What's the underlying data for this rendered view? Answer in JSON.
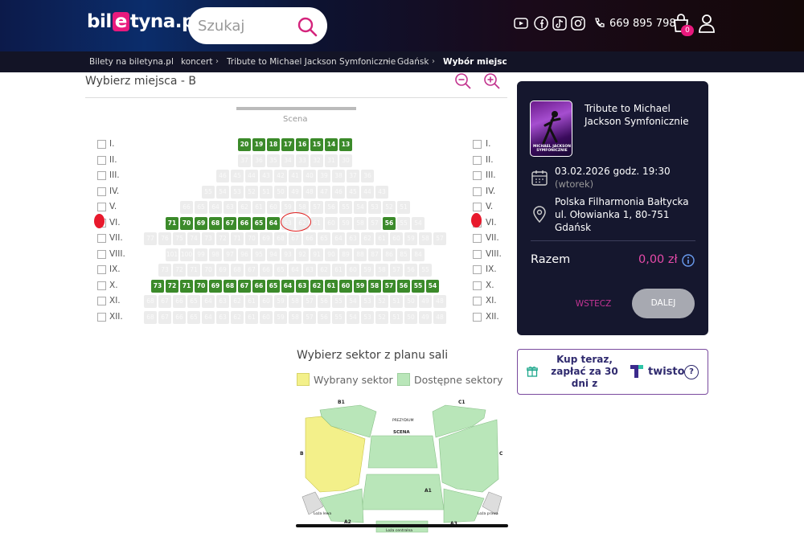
{
  "header": {
    "logo_prefix": "bil",
    "logo_e": "e",
    "logo_suffix": "tyna.pl",
    "search_placeholder": "Szukaj",
    "phone": "669 895 798",
    "cart_count": "0",
    "social_icons": [
      "youtube-icon",
      "facebook-icon",
      "tiktok-icon",
      "instagram-icon"
    ]
  },
  "breadcrumb": [
    "Bilety na biletyna.pl",
    "koncert",
    "Tribute to Michael Jackson Symfonicznie",
    "Gdańsk",
    "Wybór miejsc"
  ],
  "seat_map": {
    "title": "Wybierz miejsca - B",
    "stage_label": "Scena",
    "rows": [
      {
        "label": "I.",
        "seats": [
          {
            "n": "20",
            "a": 1
          },
          {
            "n": "19",
            "a": 1
          },
          {
            "n": "18",
            "a": 1
          },
          {
            "n": "17",
            "a": 1
          },
          {
            "n": "16",
            "a": 1
          },
          {
            "n": "15",
            "a": 1
          },
          {
            "n": "14",
            "a": 1
          },
          {
            "n": "13",
            "a": 1
          }
        ]
      },
      {
        "label": "II.",
        "seats": [
          {
            "n": "37",
            "a": 0
          },
          {
            "n": "36",
            "a": 0
          },
          {
            "n": "35",
            "a": 0
          },
          {
            "n": "34",
            "a": 0
          },
          {
            "n": "33",
            "a": 0
          },
          {
            "n": "32",
            "a": 0
          },
          {
            "n": "31",
            "a": 0
          },
          {
            "n": "30",
            "a": 0
          }
        ]
      },
      {
        "label": "III.",
        "seats": [
          {
            "n": "46",
            "a": 0
          },
          {
            "n": "45",
            "a": 0
          },
          {
            "n": "44",
            "a": 0
          },
          {
            "n": "43",
            "a": 0
          },
          {
            "n": "42",
            "a": 0
          },
          {
            "n": "41",
            "a": 0
          },
          {
            "n": "40",
            "a": 0
          },
          {
            "n": "39",
            "a": 0
          },
          {
            "n": "38",
            "a": 0
          },
          {
            "n": "37",
            "a": 0
          },
          {
            "n": "36",
            "a": 0
          }
        ]
      },
      {
        "label": "IV.",
        "seats": [
          {
            "n": "55",
            "a": 0
          },
          {
            "n": "54",
            "a": 0
          },
          {
            "n": "53",
            "a": 0
          },
          {
            "n": "52",
            "a": 0
          },
          {
            "n": "51",
            "a": 0
          },
          {
            "n": "50",
            "a": 0
          },
          {
            "n": "49",
            "a": 0
          },
          {
            "n": "48",
            "a": 0
          },
          {
            "n": "47",
            "a": 0
          },
          {
            "n": "46",
            "a": 0
          },
          {
            "n": "45",
            "a": 0
          },
          {
            "n": "44",
            "a": 0
          },
          {
            "n": "43",
            "a": 0
          }
        ]
      },
      {
        "label": "V.",
        "seats": [
          {
            "n": "66",
            "a": 0
          },
          {
            "n": "65",
            "a": 0
          },
          {
            "n": "64",
            "a": 0
          },
          {
            "n": "63",
            "a": 0
          },
          {
            "n": "62",
            "a": 0
          },
          {
            "n": "61",
            "a": 0
          },
          {
            "n": "60",
            "a": 0
          },
          {
            "n": "59",
            "a": 0
          },
          {
            "n": "58",
            "a": 0
          },
          {
            "n": "57",
            "a": 0
          },
          {
            "n": "56",
            "a": 0
          },
          {
            "n": "55",
            "a": 0
          },
          {
            "n": "54",
            "a": 0
          },
          {
            "n": "53",
            "a": 0
          },
          {
            "n": "52",
            "a": 0
          },
          {
            "n": "51",
            "a": 0
          }
        ]
      },
      {
        "label": "VI.",
        "seats": [
          {
            "n": "71",
            "a": 1
          },
          {
            "n": "70",
            "a": 1
          },
          {
            "n": "69",
            "a": 1
          },
          {
            "n": "68",
            "a": 1
          },
          {
            "n": "67",
            "a": 1
          },
          {
            "n": "66",
            "a": 1
          },
          {
            "n": "65",
            "a": 1
          },
          {
            "n": "64",
            "a": 1
          },
          {
            "n": "63",
            "a": 0
          },
          {
            "n": "62",
            "a": 0
          },
          {
            "n": "61",
            "a": 0
          },
          {
            "n": "60",
            "a": 0
          },
          {
            "n": "59",
            "a": 0
          },
          {
            "n": "58",
            "a": 0
          },
          {
            "n": "57",
            "a": 0
          },
          {
            "n": "56",
            "a": 1
          },
          {
            "n": "55",
            "a": 0
          },
          {
            "n": "54",
            "a": 0
          }
        ]
      },
      {
        "label": "VII.",
        "seats": [
          {
            "n": "77",
            "a": 0
          },
          {
            "n": "76",
            "a": 0
          },
          {
            "n": "75",
            "a": 0
          },
          {
            "n": "74",
            "a": 0
          },
          {
            "n": "73",
            "a": 0
          },
          {
            "n": "72",
            "a": 0
          },
          {
            "n": "71",
            "a": 0
          },
          {
            "n": "70",
            "a": 0
          },
          {
            "n": "69",
            "a": 0
          },
          {
            "n": "68",
            "a": 0
          },
          {
            "n": "67",
            "a": 0
          },
          {
            "n": "66",
            "a": 0
          },
          {
            "n": "65",
            "a": 0
          },
          {
            "n": "64",
            "a": 0
          },
          {
            "n": "63",
            "a": 0
          },
          {
            "n": "62",
            "a": 0
          },
          {
            "n": "61",
            "a": 0
          },
          {
            "n": "60",
            "a": 0
          },
          {
            "n": "59",
            "a": 0
          },
          {
            "n": "58",
            "a": 0
          },
          {
            "n": "57",
            "a": 0
          }
        ]
      },
      {
        "label": "VIII.",
        "seats": [
          {
            "n": "101",
            "a": 0
          },
          {
            "n": "100",
            "a": 0
          },
          {
            "n": "99",
            "a": 0
          },
          {
            "n": "98",
            "a": 0
          },
          {
            "n": "97",
            "a": 0
          },
          {
            "n": "96",
            "a": 0
          },
          {
            "n": "95",
            "a": 0
          },
          {
            "n": "94",
            "a": 0
          },
          {
            "n": "93",
            "a": 0
          },
          {
            "n": "92",
            "a": 0
          },
          {
            "n": "91",
            "a": 0
          },
          {
            "n": "90",
            "a": 0
          },
          {
            "n": "89",
            "a": 0
          },
          {
            "n": "88",
            "a": 0
          },
          {
            "n": "87",
            "a": 0
          },
          {
            "n": "86",
            "a": 0
          },
          {
            "n": "85",
            "a": 0
          },
          {
            "n": "84",
            "a": 0
          }
        ]
      },
      {
        "label": "IX.",
        "seats": [
          {
            "n": "73",
            "a": 0
          },
          {
            "n": "72",
            "a": 0
          },
          {
            "n": "71",
            "a": 0
          },
          {
            "n": "70",
            "a": 0
          },
          {
            "n": "69",
            "a": 0
          },
          {
            "n": "68",
            "a": 0
          },
          {
            "n": "67",
            "a": 0
          },
          {
            "n": "66",
            "a": 0
          },
          {
            "n": "65",
            "a": 0
          },
          {
            "n": "64",
            "a": 0
          },
          {
            "n": "63",
            "a": 0
          },
          {
            "n": "62",
            "a": 0
          },
          {
            "n": "61",
            "a": 0
          },
          {
            "n": "60",
            "a": 0
          },
          {
            "n": "59",
            "a": 0
          },
          {
            "n": "58",
            "a": 0
          },
          {
            "n": "57",
            "a": 0
          },
          {
            "n": "56",
            "a": 0
          },
          {
            "n": "55",
            "a": 0
          }
        ]
      },
      {
        "label": "X.",
        "seats": [
          {
            "n": "73",
            "a": 1
          },
          {
            "n": "72",
            "a": 1
          },
          {
            "n": "71",
            "a": 1
          },
          {
            "n": "70",
            "a": 1
          },
          {
            "n": "69",
            "a": 1
          },
          {
            "n": "68",
            "a": 1
          },
          {
            "n": "67",
            "a": 1
          },
          {
            "n": "66",
            "a": 1
          },
          {
            "n": "65",
            "a": 1
          },
          {
            "n": "64",
            "a": 1
          },
          {
            "n": "63",
            "a": 1
          },
          {
            "n": "62",
            "a": 1
          },
          {
            "n": "61",
            "a": 1
          },
          {
            "n": "60",
            "a": 1
          },
          {
            "n": "59",
            "a": 1
          },
          {
            "n": "58",
            "a": 1
          },
          {
            "n": "57",
            "a": 1
          },
          {
            "n": "56",
            "a": 1
          },
          {
            "n": "55",
            "a": 1
          },
          {
            "n": "54",
            "a": 1
          }
        ]
      },
      {
        "label": "XI.",
        "seats": [
          {
            "n": "68",
            "a": 0
          },
          {
            "n": "67",
            "a": 0
          },
          {
            "n": "66",
            "a": 0
          },
          {
            "n": "65",
            "a": 0
          },
          {
            "n": "64",
            "a": 0
          },
          {
            "n": "63",
            "a": 0
          },
          {
            "n": "62",
            "a": 0
          },
          {
            "n": "61",
            "a": 0
          },
          {
            "n": "60",
            "a": 0
          },
          {
            "n": "59",
            "a": 0
          },
          {
            "n": "58",
            "a": 0
          },
          {
            "n": "57",
            "a": 0
          },
          {
            "n": "56",
            "a": 0
          },
          {
            "n": "55",
            "a": 0
          },
          {
            "n": "54",
            "a": 0
          },
          {
            "n": "53",
            "a": 0
          },
          {
            "n": "52",
            "a": 0
          },
          {
            "n": "51",
            "a": 0
          },
          {
            "n": "50",
            "a": 0
          },
          {
            "n": "49",
            "a": 0
          },
          {
            "n": "48",
            "a": 0
          }
        ]
      },
      {
        "label": "XII.",
        "seats": [
          {
            "n": "68",
            "a": 0
          },
          {
            "n": "67",
            "a": 0
          },
          {
            "n": "66",
            "a": 0
          },
          {
            "n": "65",
            "a": 0
          },
          {
            "n": "64",
            "a": 0
          },
          {
            "n": "63",
            "a": 0
          },
          {
            "n": "62",
            "a": 0
          },
          {
            "n": "61",
            "a": 0
          },
          {
            "n": "60",
            "a": 0
          },
          {
            "n": "59",
            "a": 0
          },
          {
            "n": "58",
            "a": 0
          },
          {
            "n": "57",
            "a": 0
          },
          {
            "n": "56",
            "a": 0
          },
          {
            "n": "55",
            "a": 0
          },
          {
            "n": "54",
            "a": 0
          },
          {
            "n": "53",
            "a": 0
          },
          {
            "n": "52",
            "a": 0
          },
          {
            "n": "51",
            "a": 0
          },
          {
            "n": "50",
            "a": 0
          },
          {
            "n": "49",
            "a": 0
          },
          {
            "n": "48",
            "a": 0
          }
        ]
      }
    ]
  },
  "sector_plan": {
    "title": "Wybierz sektor z planu sali",
    "legend_selected": "Wybrany sektor",
    "legend_available": "Dostępne sektory",
    "color_selected": "#f3f08a",
    "color_available": "#b9e6b9",
    "labels": {
      "b1": "B1",
      "c1": "C1",
      "b": "B",
      "c": "C",
      "a1": "A1",
      "a2": "A2",
      "a3": "A3",
      "scena": "SCENA",
      "prezydium": "PREZYDIUM",
      "loza_lewa": "Loża lewa",
      "loza_prawa": "Loża prawa",
      "loza_centralna": "Loża centralna"
    }
  },
  "event": {
    "title": "Tribute to Michael Jackson Symfonicznie",
    "poster_text": "MICHAEL JACKSON SYMFONICZNIE",
    "date": "03.02.2026 godz. 19:30",
    "weekday": "(wtorek)",
    "venue": "Polska Filharmonia Bałtycka",
    "address": "ul. Ołowianka 1, 80-751",
    "city": "Gdańsk",
    "total_label": "Razem",
    "total_value": "0,00 zł",
    "back_label": "WSTECZ",
    "next_label": "DALEJ"
  },
  "twisto": {
    "text": "Kup teraz, zapłać za 30 dni z",
    "brand": "twisto",
    "help": "?"
  }
}
